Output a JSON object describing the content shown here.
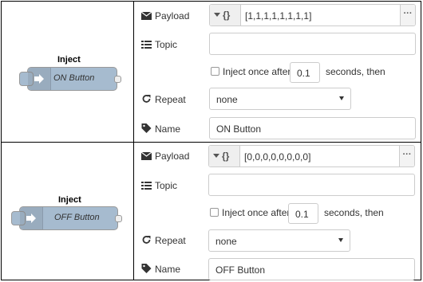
{
  "fields": {
    "payload_label": "Payload",
    "topic_label": "Topic",
    "inject_once_label": "Inject once after",
    "seconds_then_label": "seconds, then",
    "repeat_label": "Repeat",
    "name_label": "Name"
  },
  "rows": [
    {
      "node_title": "Inject",
      "node_label": "ON Button",
      "payload_type_glyph": "{}",
      "payload_value": "[1,1,1,1,1,1,1,1]",
      "topic_value": "",
      "inject_delay": "0.1",
      "repeat_value": "none",
      "name_value": "ON Button"
    },
    {
      "node_title": "Inject",
      "node_label": "OFF Button",
      "payload_type_glyph": "{}",
      "payload_value": "[0,0,0,0,0,0,0,0]",
      "topic_value": "",
      "inject_delay": "0.1",
      "repeat_value": "none",
      "name_value": "OFF Button"
    }
  ],
  "icons": {
    "payload": "envelope-icon",
    "topic": "list-icon",
    "repeat": "repeat-icon",
    "name": "tag-icon",
    "node": "inject-arrow-icon",
    "expand": "ellipsis-icon"
  },
  "colors": {
    "node_fill": "#a6bbcf",
    "node_border": "#999999",
    "field_border": "#cccccc"
  }
}
